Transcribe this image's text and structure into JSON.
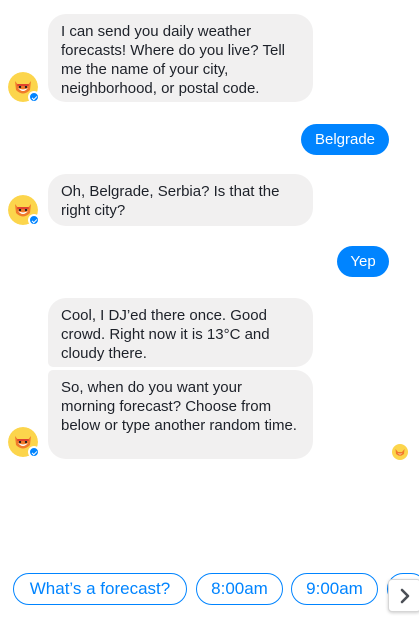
{
  "messages": {
    "bot_1": "I can send you daily weather forecasts! Where do you live? Tell me the name of your city, neighborhood, or postal code.",
    "user_1": "Belgrade",
    "bot_2": "Oh, Belgrade, Serbia? Is that the right city?",
    "user_2": "Yep",
    "bot_3": "Cool, I DJ’ed there once. Good crowd. Right now it is 13°C and cloudy there.",
    "bot_4": "So, when do you want your morning forecast? Choose from below or type another random time."
  },
  "quick_replies": [
    "What’s a forecast?",
    "8:00am",
    "9:00am"
  ],
  "icons": {
    "avatar": "fox-bot-avatar-icon",
    "messenger_badge": "messenger-badge-icon",
    "seen": "seen-avatar-icon",
    "scroll": "chevron-right-icon"
  },
  "colors": {
    "accent": "#0084ff",
    "incoming_bubble": "#f1f0f0",
    "avatar_bg": "#fcd54c",
    "fox": "#f07a2b"
  }
}
